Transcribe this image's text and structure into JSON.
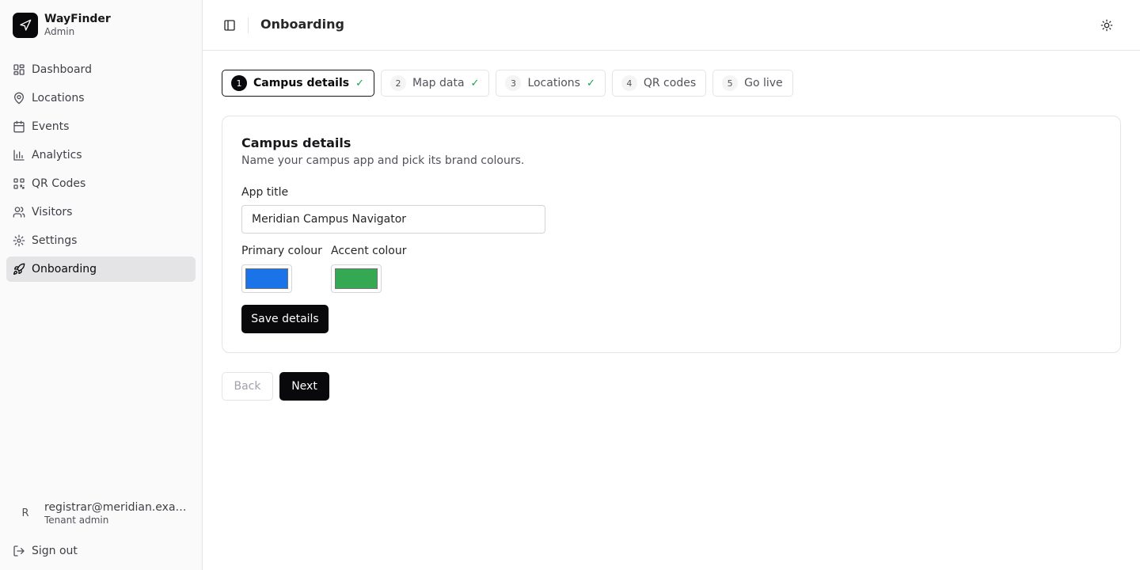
{
  "brand": {
    "name": "WayFinder",
    "subtitle": "Admin"
  },
  "sidebar": {
    "items": [
      {
        "label": "Dashboard",
        "icon": "dashboard-icon"
      },
      {
        "label": "Locations",
        "icon": "map-pin-icon"
      },
      {
        "label": "Events",
        "icon": "calendar-icon"
      },
      {
        "label": "Analytics",
        "icon": "bar-chart-icon"
      },
      {
        "label": "QR Codes",
        "icon": "qr-code-icon"
      },
      {
        "label": "Visitors",
        "icon": "users-icon"
      },
      {
        "label": "Settings",
        "icon": "gear-icon"
      },
      {
        "label": "Onboarding",
        "icon": "rocket-icon",
        "active": true
      }
    ]
  },
  "user": {
    "initial": "R",
    "email": "registrar@meridian.example.edu",
    "role": "Tenant admin"
  },
  "signout": {
    "label": "Sign out"
  },
  "header": {
    "title": "Onboarding"
  },
  "steps": [
    {
      "number": "1",
      "label": "Campus details",
      "check": "✓",
      "active": true
    },
    {
      "number": "2",
      "label": "Map data",
      "check": "✓"
    },
    {
      "number": "3",
      "label": "Locations",
      "check": "✓"
    },
    {
      "number": "4",
      "label": "QR codes"
    },
    {
      "number": "5",
      "label": "Go live"
    }
  ],
  "card": {
    "title": "Campus details",
    "description": "Name your campus app and pick its brand colours.",
    "app_title_label": "App title",
    "app_title_value": "Meridian Campus Navigator",
    "primary_colour_label": "Primary colour",
    "primary_colour_value": "#1a73e8",
    "accent_colour_label": "Accent colour",
    "accent_colour_value": "#34a853",
    "save_label": "Save details"
  },
  "footer": {
    "back_label": "Back",
    "next_label": "Next"
  }
}
